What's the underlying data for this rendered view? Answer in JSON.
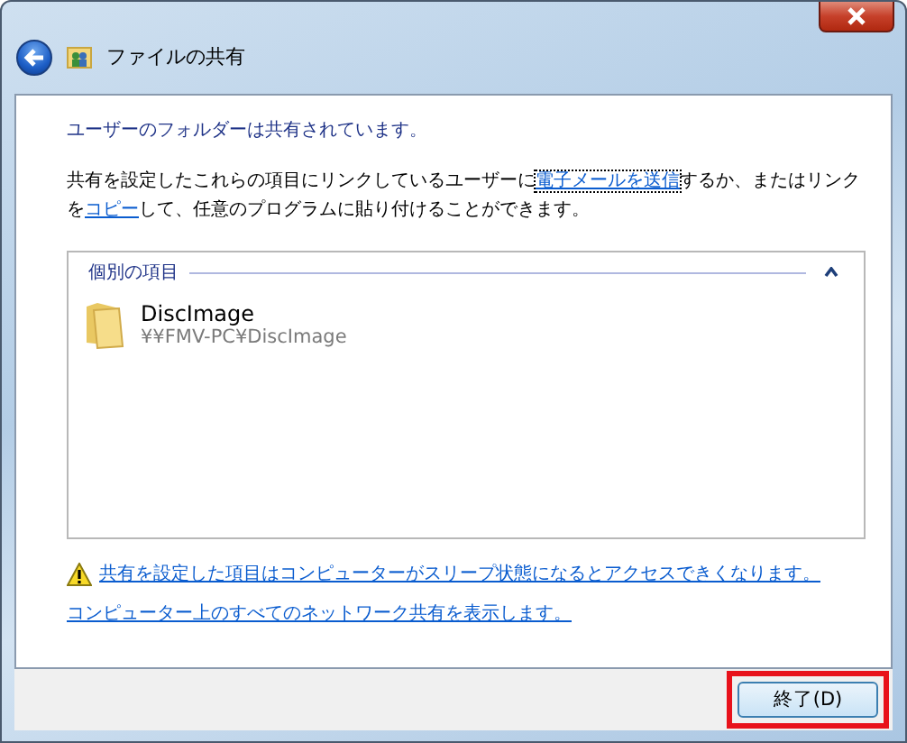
{
  "window": {
    "title": "ファイルの共有"
  },
  "message": "ユーザーのフォルダーは共有されています。",
  "description": [
    {
      "kind": "text",
      "text": "共有を設定したこれらの項目にリンクしているユーザーに"
    },
    {
      "kind": "link",
      "text": "電子メールを送信",
      "focused": true
    },
    {
      "kind": "text",
      "text": "するか、またはリンクを"
    },
    {
      "kind": "link",
      "text": "コピー",
      "focused": false
    },
    {
      "kind": "text",
      "text": "して、任意のプログラムに貼り付けることができます。"
    }
  ],
  "group": {
    "title": "個別の項目",
    "expanded": true,
    "items": [
      {
        "name": "DiscImage",
        "path": "¥¥FMV-PC¥DiscImage"
      }
    ]
  },
  "warning_link": "共有を設定した項目はコンピューターがスリープ状態になるとアクセスできくなります。",
  "network_link": "コンピューター上のすべてのネットワーク共有を表示します。",
  "buttons": [
    {
      "label": "終了(D)",
      "highlighted": true
    }
  ]
}
